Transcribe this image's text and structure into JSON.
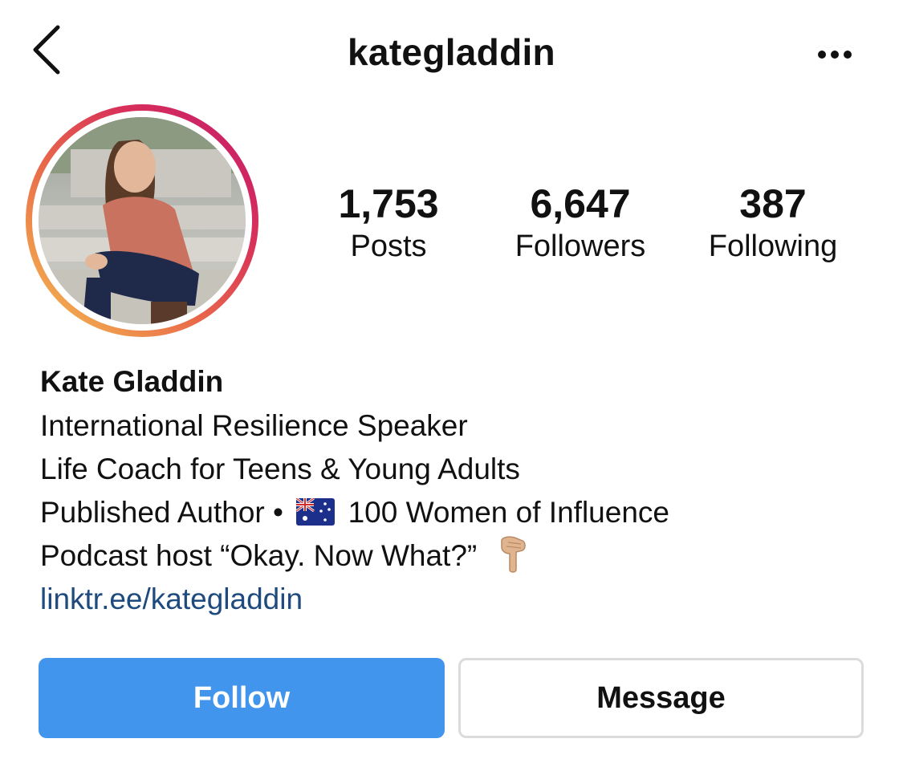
{
  "header": {
    "back_icon": "chevron-left-icon",
    "username": "kategladdin",
    "more_icon": "more-horizontal-icon"
  },
  "profile": {
    "avatar_alt": "profile-photo",
    "story_ring_colors": [
      "#c2186f",
      "#e86a4a",
      "#f5c061"
    ]
  },
  "stats": {
    "posts": {
      "value": "1,753",
      "label": "Posts"
    },
    "followers": {
      "value": "6,647",
      "label": "Followers"
    },
    "following": {
      "value": "387",
      "label": "Following"
    }
  },
  "bio": {
    "name": "Kate Gladdin",
    "line1": "International Resilience Speaker",
    "line2": "Life Coach for Teens & Young Adults",
    "line3_before": "Published Author •",
    "line3_flag_icon": "australia-flag-icon",
    "line3_after": "100 Women of Influence",
    "line4": "Podcast host “Okay. Now What?”",
    "line4_emoji_icon": "pointing-down-hand-icon",
    "link": "linktr.ee/kategladdin",
    "link_color": "#1e4a7e"
  },
  "actions": {
    "follow_label": "Follow",
    "follow_color": "#4295ec",
    "message_label": "Message"
  }
}
